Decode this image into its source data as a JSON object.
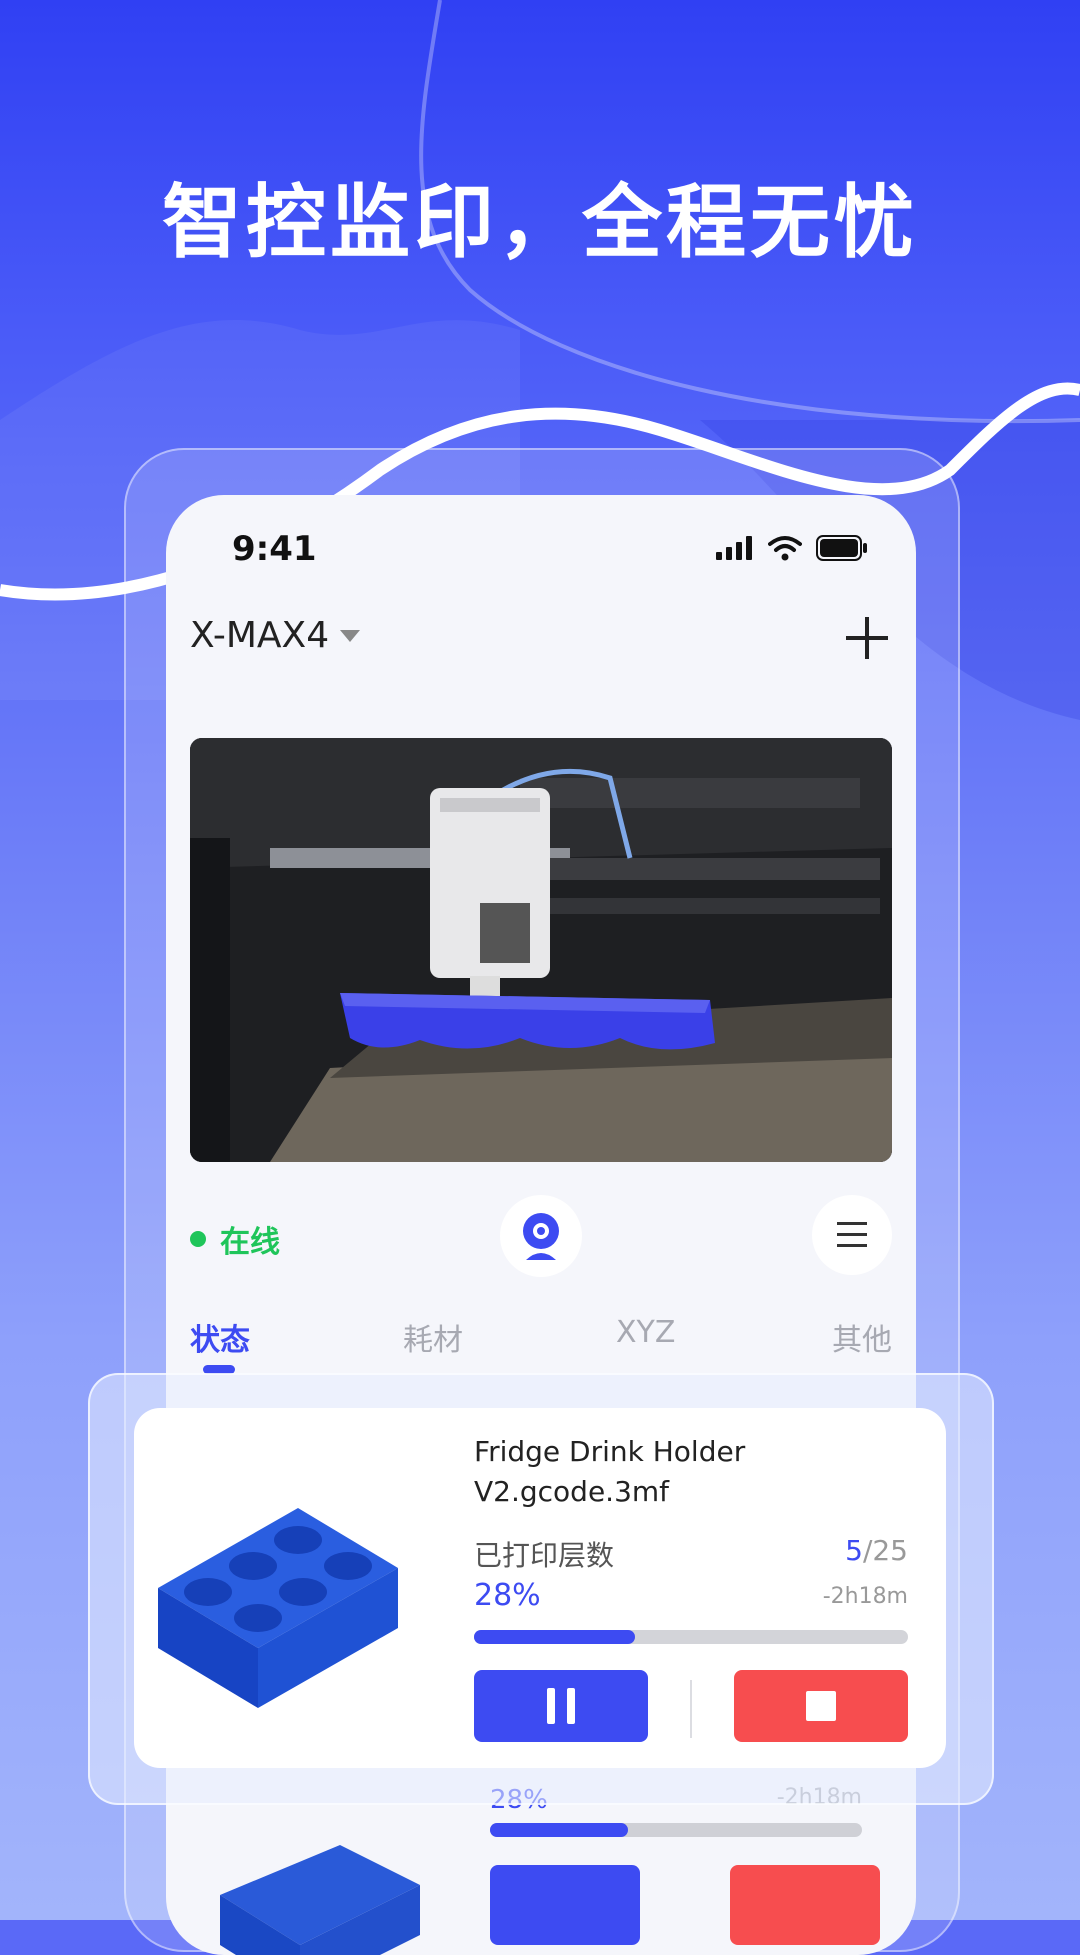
{
  "headline": "智控监印，全程无忧",
  "status_bar": {
    "time": "9:41"
  },
  "device": {
    "name": "X-MAX4"
  },
  "camera_feed": {
    "icon": "printer-camera-feed"
  },
  "status": {
    "online_label": "在线"
  },
  "tabs": [
    {
      "label": "状态",
      "active": true
    },
    {
      "label": "耗材",
      "active": false
    },
    {
      "label": "XYZ",
      "active": false
    },
    {
      "label": "其他",
      "active": false
    }
  ],
  "job": {
    "file_name": "Fridge Drink Holder V2.gcode.3mf",
    "layers_label": "已打印层数",
    "layers_done": "5",
    "layers_total": "/25",
    "percent": "28%",
    "remaining": "-2h18m",
    "progress_fraction": 0.37
  },
  "ghost_job": {
    "percent": "28%",
    "remaining": "-2h18m"
  },
  "colors": {
    "accent": "#3d4bf2",
    "stop": "#f74d4f",
    "online": "#1fc55a"
  }
}
